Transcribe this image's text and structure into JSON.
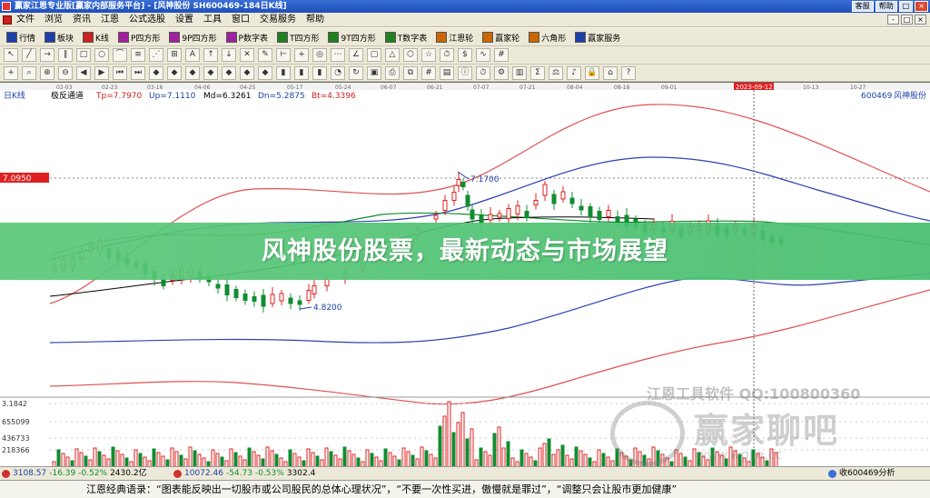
{
  "titlebar": {
    "title": "赢家江恩专业版[赢家内部服务平台] - [风神股份 SH600469-184日K线]",
    "buttons": [
      "客服",
      "帮助",
      "□",
      "×"
    ]
  },
  "menu": {
    "items": [
      "文件",
      "浏览",
      "资讯",
      "江恩",
      "公式选股",
      "设置",
      "工具",
      "窗口",
      "交易服务",
      "帮助"
    ],
    "window_buttons": [
      "-",
      "□",
      "×"
    ]
  },
  "toolbar1": [
    {
      "label": "行情",
      "color": "#1c3fa8"
    },
    {
      "label": "板块",
      "color": "#1c3fa8"
    },
    {
      "label": "K线",
      "color": "#cc2222"
    },
    {
      "label": "P四方形",
      "color": "#a020a0"
    },
    {
      "label": "9P四方形",
      "color": "#a020a0"
    },
    {
      "label": "P数字表",
      "color": "#a020a0"
    },
    {
      "label": "T四方形",
      "color": "#208020"
    },
    {
      "label": "9T四方形",
      "color": "#208020"
    },
    {
      "label": "T数字表",
      "color": "#208020"
    },
    {
      "label": "江恩轮",
      "color": "#cc6600"
    },
    {
      "label": "赢家轮",
      "color": "#cc6600"
    },
    {
      "label": "六角形",
      "color": "#cc6600"
    },
    {
      "label": "赢家服务",
      "color": "#1c3fa8"
    }
  ],
  "toolbar2_icons": [
    "pointer-icon",
    "line-icon",
    "ray-icon",
    "channel-icon",
    "rect-icon",
    "circle-icon",
    "arc-icon",
    "fib-icon",
    "gann-fan-icon",
    "gann-box-icon",
    "text-icon",
    "arrow-up-icon",
    "arrow-down-icon",
    "delete-icon",
    "pen-icon",
    "ruler-icon",
    "cross-icon",
    "cycle-icon",
    "speed-icon",
    "angle-icon",
    "square-icon",
    "triangle-icon",
    "hexagon-icon",
    "star-icon",
    "time-icon",
    "price-icon",
    "wave-icon",
    "grid-icon"
  ],
  "toolbar3_icons": [
    "cross-cursor-icon",
    "magnify-icon",
    "zoom-in-icon",
    "zoom-out-icon",
    "left-icon",
    "right-icon",
    "first-icon",
    "last-icon",
    "diamond-icon",
    "diamond-icon",
    "diamond-icon",
    "diamond-icon",
    "diamond-icon",
    "diamond-icon",
    "diamond-icon",
    "bar-icon",
    "bar-icon",
    "bar-icon",
    "pie-icon",
    "refresh-icon",
    "save-icon",
    "print-icon",
    "copy-icon",
    "grid-icon",
    "table-icon",
    "info-icon",
    "time-icon",
    "settings-icon",
    "chart-icon",
    "stats-icon",
    "weight-icon",
    "sound-icon",
    "lock-icon",
    "home-icon",
    "help-icon"
  ],
  "chart": {
    "period_label": "日K线",
    "indicator_name": "极反通道",
    "indicators": [
      {
        "label": "Tp=7.7970",
        "color": "#cc2222"
      },
      {
        "label": "Up=7.1110",
        "color": "#1c3fa8"
      },
      {
        "label": "Md=6.3261",
        "color": "#000000"
      },
      {
        "label": "Dn=5.2875",
        "color": "#1c3fa8"
      },
      {
        "label": "Bt=4.3396",
        "color": "#cc2222"
      }
    ],
    "stock_code": "600469",
    "stock_name": "风神股份",
    "price_tag": "7.0950",
    "high_label": "7.1700",
    "low_label": "4.8200",
    "crosshair_date": "2023-09-12",
    "date_ticks": [
      "02-03",
      "02-23",
      "03-16",
      "04-06",
      "04-25",
      "05-17",
      "05-24",
      "06-07",
      "06-21",
      "07-07",
      "07-21",
      "08-04",
      "08-18",
      "09-01",
      "09-12",
      "09-29",
      "10-13",
      "10-27"
    ],
    "volume_ticks": [
      "3.1842",
      "655099",
      "436733",
      "218366"
    ],
    "volume_unit_note": ""
  },
  "watermark": {
    "line": "江恩工具软件  QQ:100800360",
    "logo_text": "赢家聊吧",
    "logo_url": "www.wgjie.cc"
  },
  "banner": {
    "title": "风神股份股票，最新动态与市场展望"
  },
  "infobar": {
    "sh_index": "3108.57",
    "sh_change": "-16.39",
    "sh_pct": "-0.52%",
    "sh_amount": "2430.2亿",
    "sz_index": "10072.46",
    "sz_change": "-54.73",
    "sz_pct": "-0.53%",
    "sz_amount": "3302.4",
    "right_text": "收600469分析"
  },
  "quotebar": {
    "text": "江恩经典语录：“图表能反映出一切股市或公司股民的总体心理状况”，“不要一次性买进，傲慢就是罪过”，“调整只会让股市更加健康”"
  }
}
